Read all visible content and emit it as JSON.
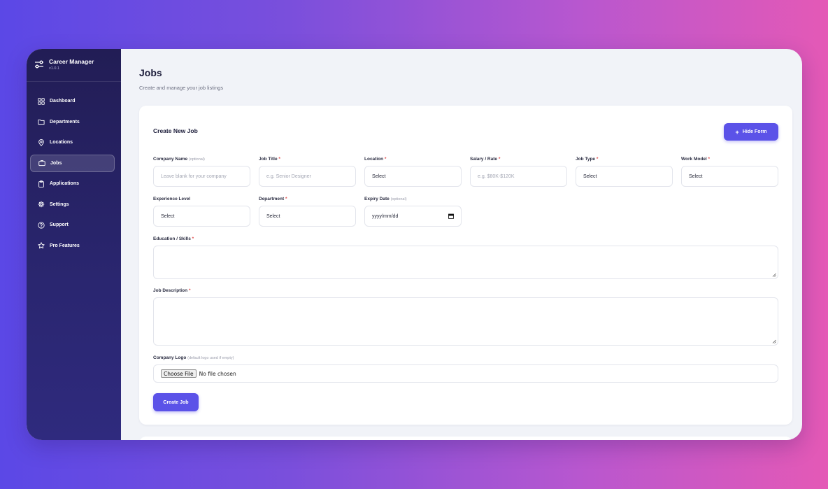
{
  "brand": {
    "name": "Career Manager",
    "version": "v1.0.1"
  },
  "sidebar": {
    "items": [
      {
        "label": "Dashboard",
        "icon": "grid-icon"
      },
      {
        "label": "Departments",
        "icon": "folder-icon"
      },
      {
        "label": "Locations",
        "icon": "map-pin-icon"
      },
      {
        "label": "Jobs",
        "icon": "briefcase-icon",
        "active": true
      },
      {
        "label": "Applications",
        "icon": "clipboard-icon"
      },
      {
        "label": "Settings",
        "icon": "gear-icon"
      },
      {
        "label": "Support",
        "icon": "help-circle-icon"
      },
      {
        "label": "Pro Features",
        "icon": "star-icon"
      }
    ]
  },
  "header": {
    "title": "Jobs",
    "subtitle": "Create and manage your job listings"
  },
  "form": {
    "title": "Create New Job",
    "hide_button": "Hide Form",
    "required_mark": "*",
    "fields": {
      "company_name": {
        "label": "Company Name",
        "note": "(optional)",
        "placeholder": "Leave blank for your company"
      },
      "job_title": {
        "label": "Job Title",
        "placeholder": "e.g. Senior Designer"
      },
      "location": {
        "label": "Location",
        "value": "Select"
      },
      "salary": {
        "label": "Salary / Rate",
        "placeholder": "e.g. $80K-$120K"
      },
      "job_type": {
        "label": "Job Type",
        "value": "Select"
      },
      "work_model": {
        "label": "Work Model",
        "value": "Select"
      },
      "experience": {
        "label": "Experience Level",
        "value": "Select"
      },
      "department": {
        "label": "Department",
        "value": "Select"
      },
      "expiry": {
        "label": "Expiry Date",
        "note": "(optional)",
        "value": "yyyy/mm/dd"
      },
      "education": {
        "label": "Education / Skills"
      },
      "description": {
        "label": "Job Description"
      },
      "logo": {
        "label": "Company Logo",
        "note": "(default logo used if empty)",
        "button": "Choose File",
        "status": "No file chosen"
      }
    },
    "submit": "Create Job"
  },
  "colors": {
    "accent": "#5b52e8",
    "sidebar": "#221d55",
    "required": "#e14b4b"
  }
}
